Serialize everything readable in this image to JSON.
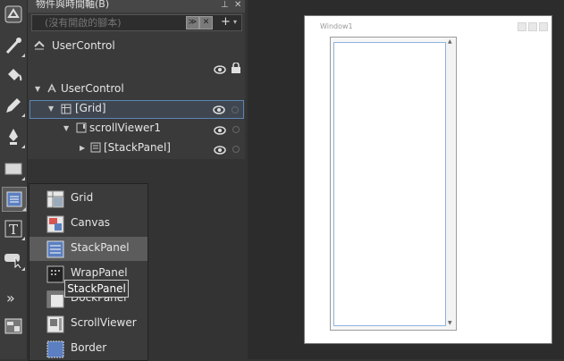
{
  "panel": {
    "title": "物件與時間軸(B)",
    "search_placeholder": "(沒有開啟的腳本)",
    "root_label": "UserControl",
    "tree": [
      {
        "label": "UserControl",
        "indent": 0
      },
      {
        "label": "[Grid]",
        "indent": 1,
        "selected": true
      },
      {
        "label": "scrollViewer1",
        "indent": 2
      },
      {
        "label": "[StackPanel]",
        "indent": 3
      }
    ]
  },
  "flyout": {
    "items": [
      {
        "label": "Grid"
      },
      {
        "label": "Canvas"
      },
      {
        "label": "StackPanel",
        "highlighted": true
      },
      {
        "label": "WrapPanel"
      },
      {
        "label": "DockPanel"
      },
      {
        "label": "ScrollViewer"
      },
      {
        "label": "Border"
      }
    ],
    "tooltip": "StackPanel"
  },
  "artboard": {
    "window_title": "Window1"
  },
  "colors": {
    "accent": "#5b86b8",
    "background": "#333333"
  }
}
